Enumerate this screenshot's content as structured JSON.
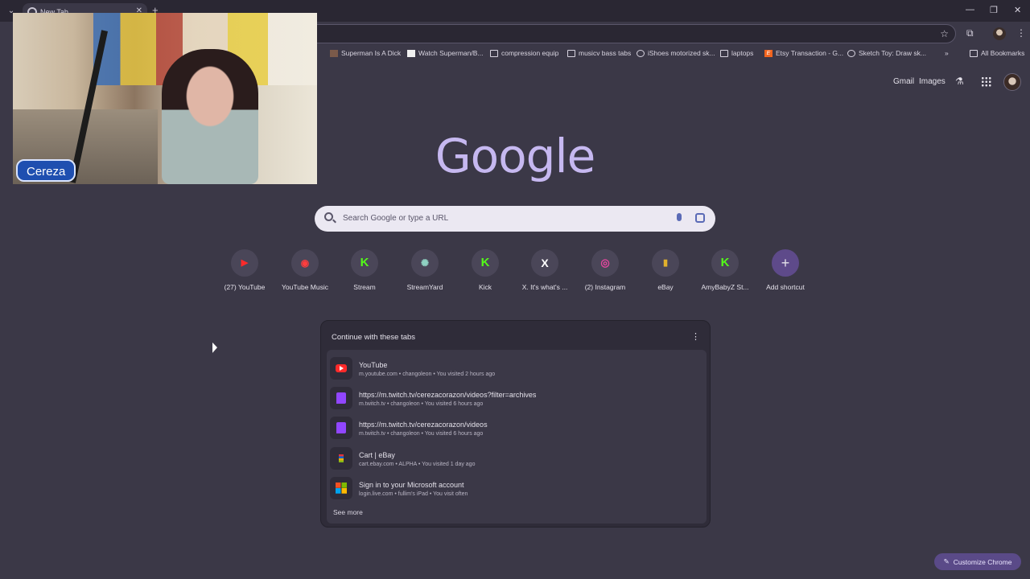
{
  "browser": {
    "tab_title": "New Tab",
    "tab_close": "✕",
    "new_tab": "+",
    "tab_menu": "⌄",
    "minimize": "—",
    "restore": "❐",
    "close": "✕"
  },
  "toolbar": {
    "star": "☆",
    "extensions": "⧉",
    "menu": "⋮"
  },
  "bookmarks": [
    {
      "label": "Superman Is A Dick",
      "icon": "img"
    },
    {
      "label": "Watch Superman/B...",
      "icon": "white"
    },
    {
      "label": "compression equip",
      "icon": "folder"
    },
    {
      "label": "musicv bass tabs",
      "icon": "folder"
    },
    {
      "label": "iShoes motorized sk...",
      "icon": "globe"
    },
    {
      "label": "laptops",
      "icon": "folder"
    },
    {
      "label": "Etsy Transaction - G...",
      "icon": "etsy"
    },
    {
      "label": "Sketch Toy: Draw sk...",
      "icon": "globe"
    }
  ],
  "bookmarks_overflow": "»",
  "all_bookmarks": "All Bookmarks",
  "webcam": {
    "name": "Cereza"
  },
  "header": {
    "gmail": "Gmail",
    "images": "Images",
    "labs": "⚗"
  },
  "logo": "Google",
  "search": {
    "placeholder": "Search Google or type a URL"
  },
  "shortcuts": [
    {
      "label": "(27) YouTube",
      "icon": "youtube-icon",
      "glyph": "▶"
    },
    {
      "label": "YouTube Music",
      "icon": "youtube-music-icon",
      "glyph": "◉"
    },
    {
      "label": "Stream",
      "icon": "kick-icon",
      "glyph": "K"
    },
    {
      "label": "StreamYard",
      "icon": "streamyard-icon",
      "glyph": "✺"
    },
    {
      "label": "Kick",
      "icon": "kick-icon",
      "glyph": "K"
    },
    {
      "label": "X. It's what's ...",
      "icon": "x-icon",
      "glyph": "X"
    },
    {
      "label": "(2) Instagram",
      "icon": "instagram-icon",
      "glyph": "◎"
    },
    {
      "label": "eBay",
      "icon": "ebay-icon",
      "glyph": "▮"
    },
    {
      "label": "AmyBabyZ St...",
      "icon": "kick-icon",
      "glyph": "K"
    },
    {
      "label": "Add shortcut",
      "icon": "plus-icon",
      "glyph": "+"
    }
  ],
  "continue_card": {
    "title": "Continue with these tabs",
    "menu": "⋮",
    "rows": [
      {
        "title": "YouTube",
        "sub": "m.youtube.com • changoleon • You visited 2 hours ago",
        "icon": "youtube"
      },
      {
        "title": "https://m.twitch.tv/cerezacorazon/videos?filter=archives",
        "sub": "m.twitch.tv • changoleon • You visited 6 hours ago",
        "icon": "twitch"
      },
      {
        "title": "https://m.twitch.tv/cerezacorazon/videos",
        "sub": "m.twitch.tv • changoleon • You visited 6 hours ago",
        "icon": "twitch"
      },
      {
        "title": "Cart | eBay",
        "sub": "cart.ebay.com • ALPHA • You visited 1 day ago",
        "icon": "ebay"
      },
      {
        "title": "Sign in to your Microsoft account",
        "sub": "login.live.com • fullim's iPad • You visit often",
        "icon": "microsoft"
      }
    ],
    "see_more": "See more"
  },
  "customize": {
    "label": "Customize Chrome",
    "icon": "✎"
  }
}
